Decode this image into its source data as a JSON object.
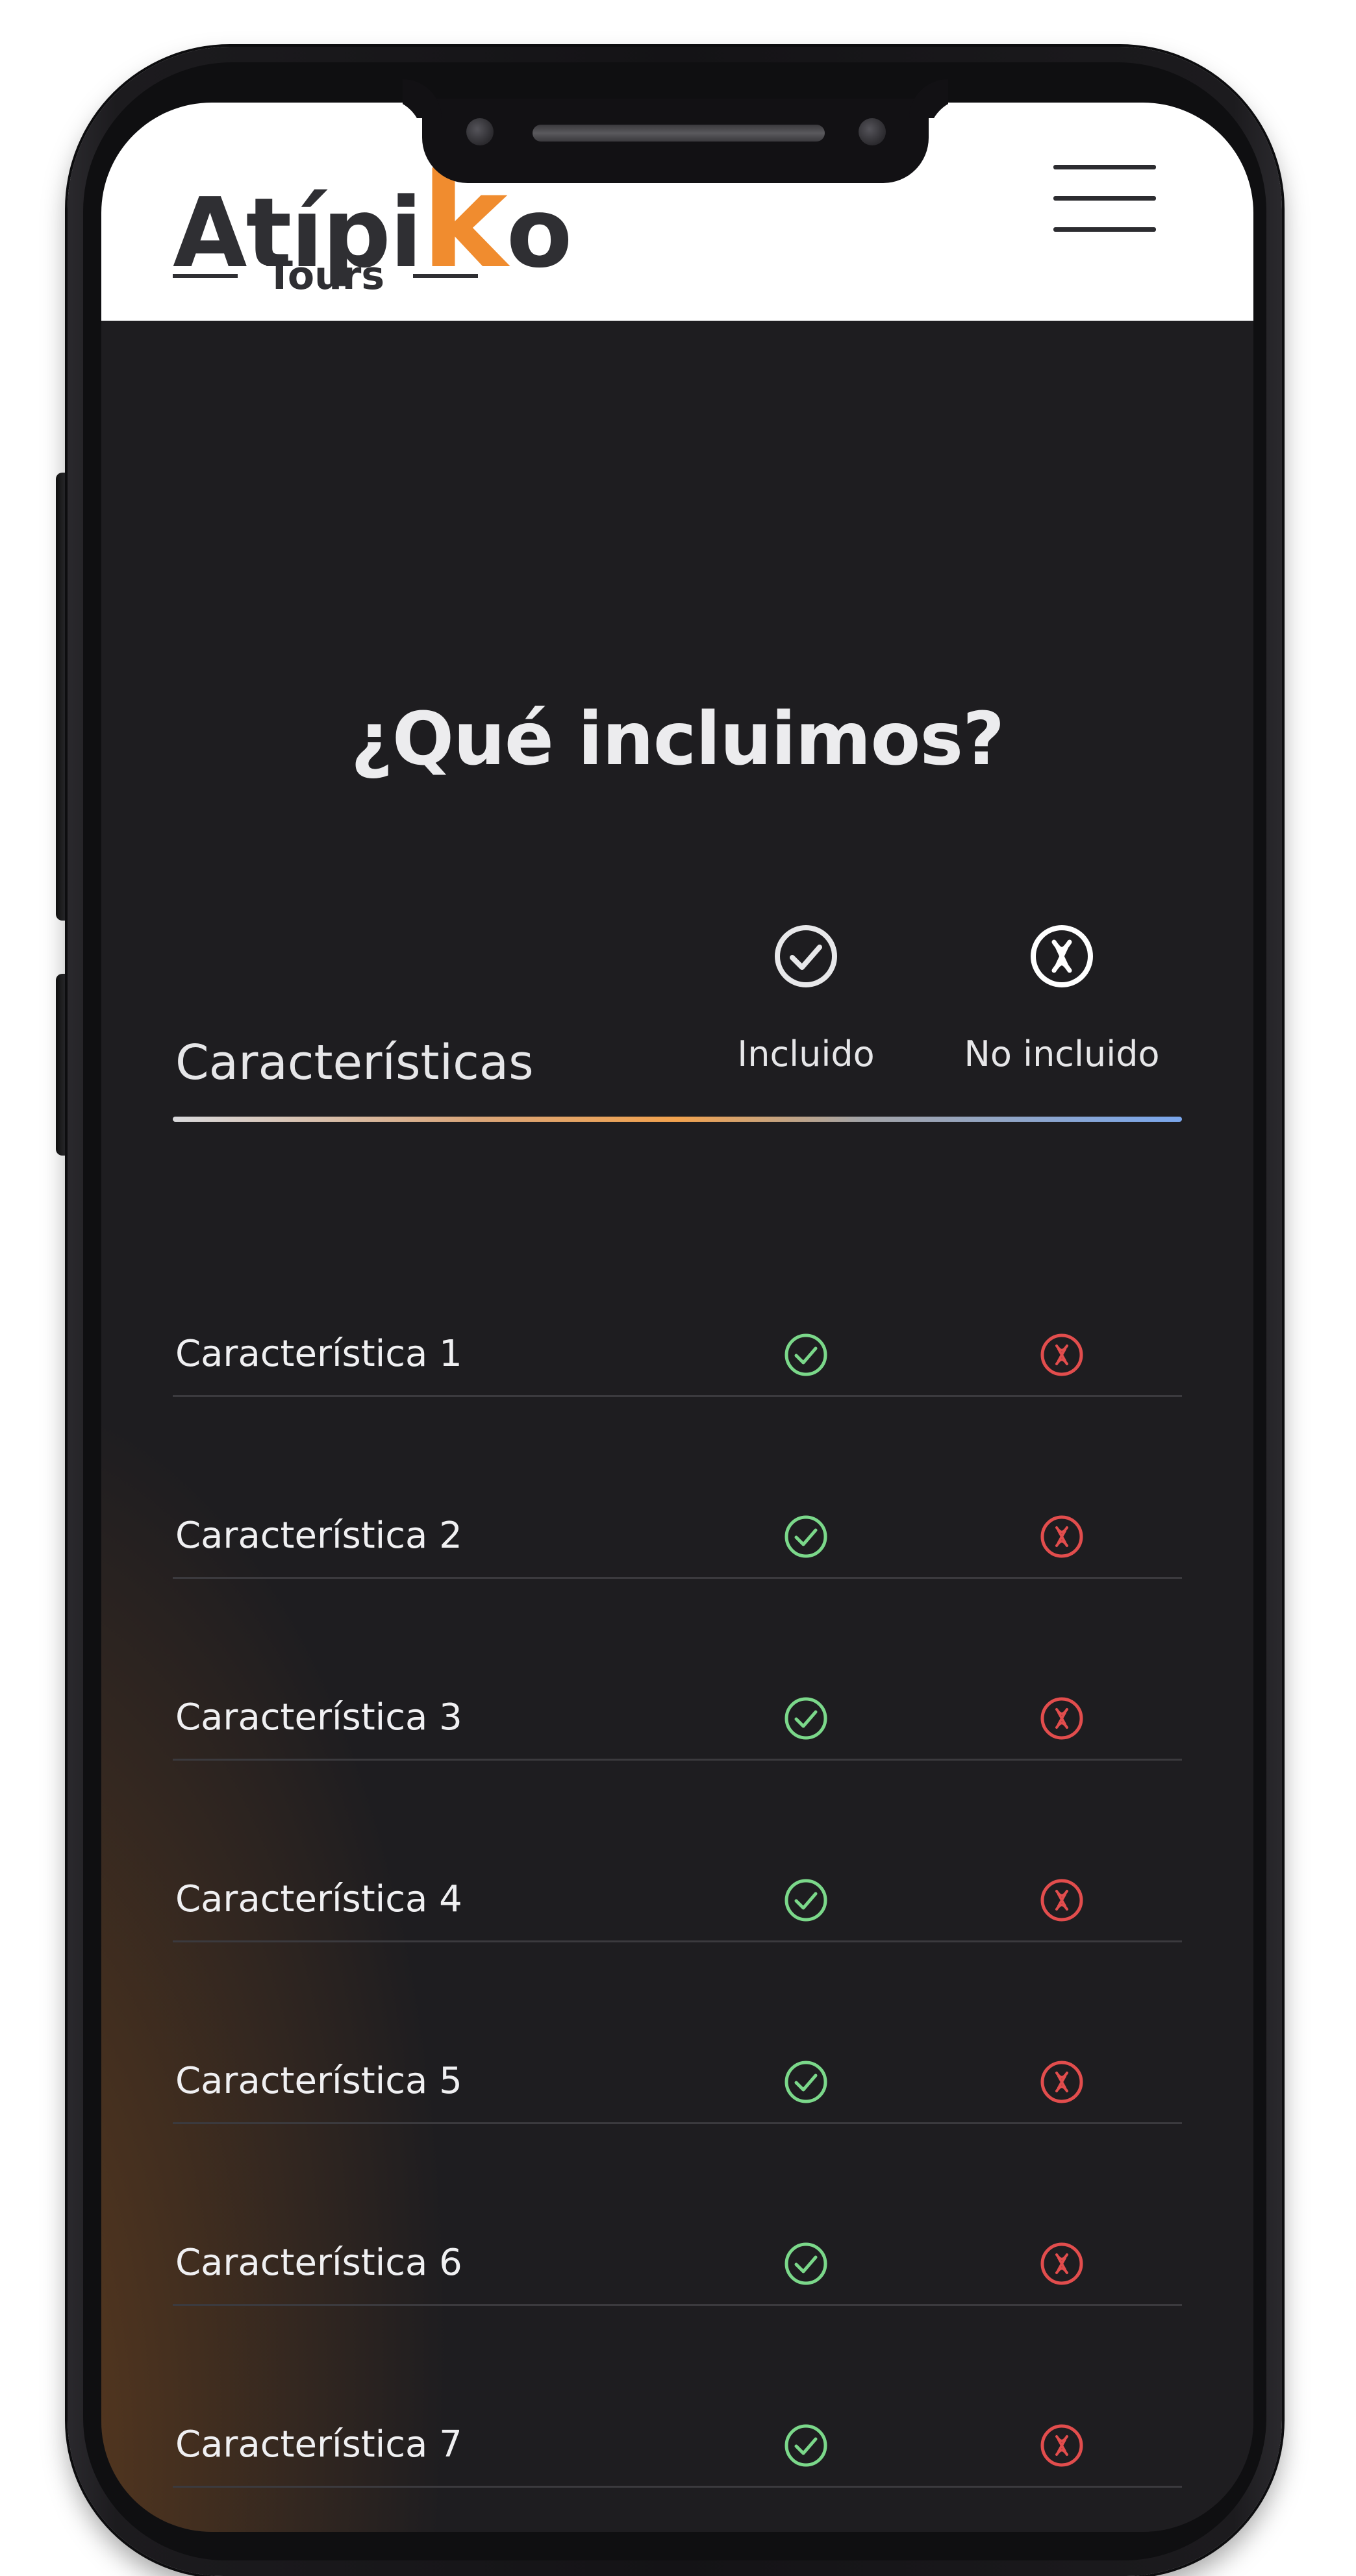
{
  "header": {
    "logo_word_prefix": "Atípi",
    "logo_word_k": "k",
    "logo_word_suffix": "o",
    "logo_tagline": "Tours",
    "menu_icon": "hamburger-menu-icon"
  },
  "section": {
    "title": "¿Qué incluimos?",
    "features_header": "Características",
    "included_header": "Incluido",
    "not_included_header": "No incluido",
    "included_icon": "check-circle-icon",
    "not_included_icon": "x-circle-icon"
  },
  "rows": [
    {
      "label": "Característica 1"
    },
    {
      "label": "Característica 2"
    },
    {
      "label": "Característica 3"
    },
    {
      "label": "Característica 4"
    },
    {
      "label": "Característica 5"
    },
    {
      "label": "Característica 6"
    },
    {
      "label": "Característica 7"
    }
  ],
  "colors": {
    "background": "#1e1d20",
    "accent_orange": "#f08c2f",
    "check_green": "#7bd88a",
    "cross_red": "#e24d4d",
    "text": "#f0f0f2"
  }
}
